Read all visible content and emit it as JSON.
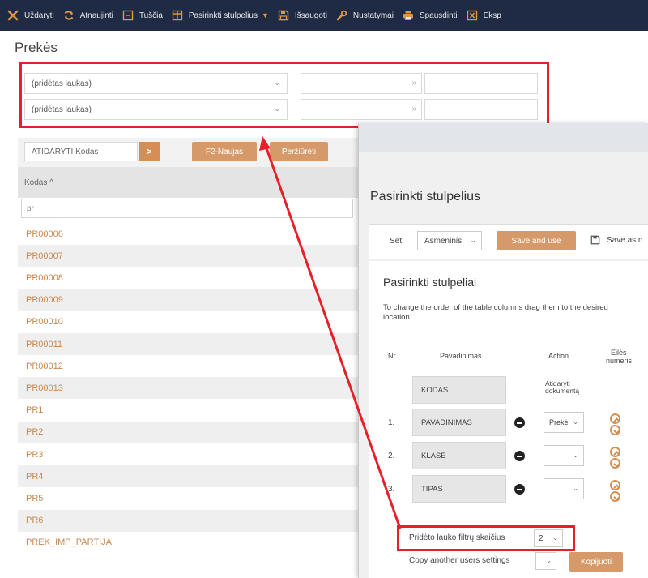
{
  "toolbar": {
    "items": [
      {
        "label": "Uždaryti",
        "icon": "close-icon"
      },
      {
        "label": "Atnaujinti",
        "icon": "refresh-icon"
      },
      {
        "label": "Tuščia",
        "icon": "blank-icon"
      },
      {
        "label": "Pasirinkti stulpelius",
        "icon": "columns-icon"
      },
      {
        "label": "Išsaugoti",
        "icon": "save-icon"
      },
      {
        "label": "Nustatymai",
        "icon": "wrench-icon"
      },
      {
        "label": "Spausdinti",
        "icon": "print-icon"
      },
      {
        "label": "Eksp",
        "icon": "export-icon"
      }
    ]
  },
  "page": {
    "title": "Prekės"
  },
  "filters": {
    "rows": [
      {
        "field": "(pridėtas laukas)",
        "range_sep": "»"
      },
      {
        "field": "(pridėtas laukas)",
        "range_sep": "»"
      }
    ]
  },
  "list": {
    "open_input": "ATIDARYTI Kodas",
    "open_button": ">",
    "new_button": "F2-Naujas",
    "view_button": "Peržiūrėti",
    "column_header": "Kodas ^",
    "column_filter": "pr",
    "rows": [
      "PR00006",
      "PR00007",
      "PR00008",
      "PR00009",
      "PR00010",
      "PR00011",
      "PR00012",
      "PR00013",
      "PR1",
      "PR2",
      "PR3",
      "PR4",
      "PR5",
      "PR6",
      "PREK_IMP_PARTIJA"
    ]
  },
  "modal": {
    "title": "Pasirinkti stulpelius",
    "set_label": "Set:",
    "set_value": "Asmeninis",
    "save_and_use": "Save and use",
    "save_as": "Save as n",
    "section_title": "Pasirinkti stulpeliai",
    "section_desc": "To change the order of the table columns drag them to the desired location.",
    "headers": {
      "nr": "Nr",
      "name": "Pavadinimas",
      "action": "Action",
      "order_1": "Eilės",
      "order_2": "numeris"
    },
    "rows": [
      {
        "nr": "",
        "name": "KODAS",
        "action_text_1": "Atidaryti",
        "action_text_2": "dokumentą"
      },
      {
        "nr": "1.",
        "name": "PAVADINIMAS",
        "action": "Prekė"
      },
      {
        "nr": "2.",
        "name": "KLASĖ",
        "action": ""
      },
      {
        "nr": "3.",
        "name": "TIPAS",
        "action": ""
      }
    ],
    "filter_count_label": "Pridėto lauko filtrų skaičius",
    "filter_count_value": "2",
    "copy_label": "Copy another users settings",
    "copy_button": "Kopijuoti"
  },
  "colors": {
    "accent": "#d58f54",
    "highlight": "#e5202a",
    "toolbar_bg": "#1f2a44"
  }
}
